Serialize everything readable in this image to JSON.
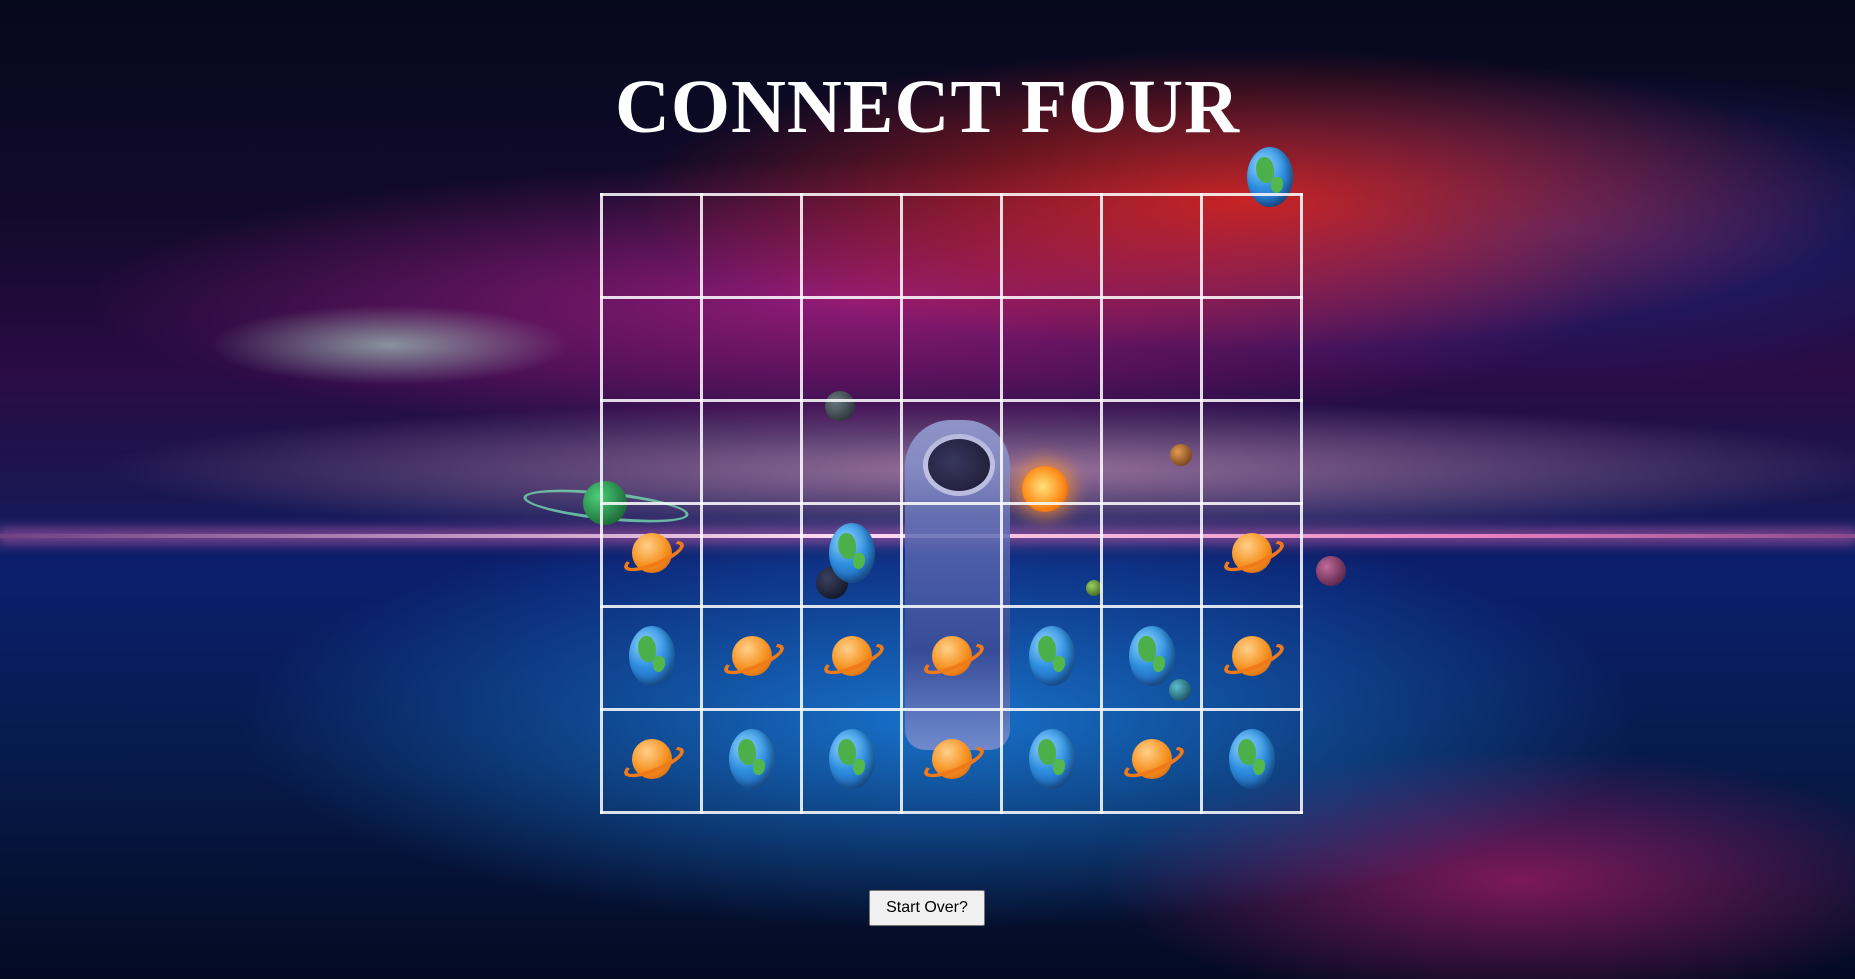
{
  "title": "CONNECT FOUR",
  "board": {
    "columns": 7,
    "rows": [
      [
        "",
        "",
        "",
        "",
        "",
        "",
        ""
      ],
      [
        "",
        "",
        "",
        "",
        "",
        "",
        ""
      ],
      [
        "",
        "",
        "",
        "",
        "",
        "",
        ""
      ],
      [
        "saturn",
        "",
        "earth",
        "",
        "",
        "",
        "saturn"
      ],
      [
        "earth",
        "saturn",
        "saturn",
        "saturn",
        "earth",
        "earth",
        "saturn"
      ],
      [
        "saturn",
        "earth",
        "earth",
        "saturn",
        "earth",
        "saturn",
        "earth"
      ]
    ],
    "pieces": {
      "earth": {
        "icon": "earth-piece-icon",
        "color": "#2f8fe0"
      },
      "saturn": {
        "icon": "saturn-piece-icon",
        "color": "#f6901e"
      }
    },
    "current_player_piece": "earth"
  },
  "start_over_label": "Start Over?"
}
